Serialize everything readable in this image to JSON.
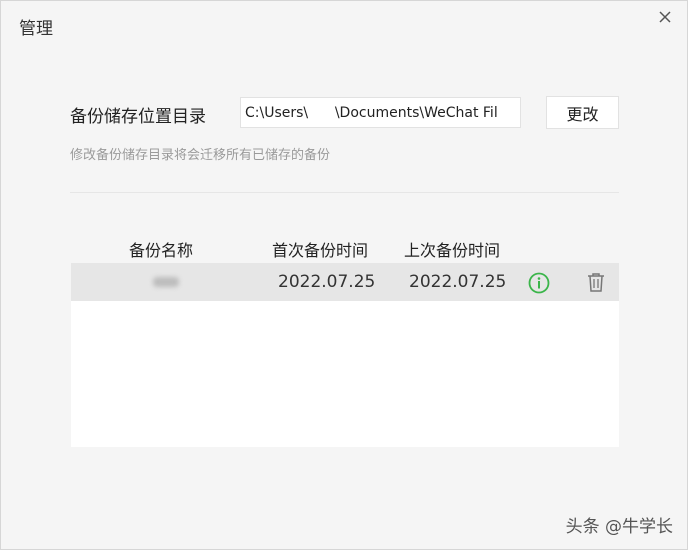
{
  "window": {
    "title": "管理"
  },
  "location": {
    "label": "备份储存位置目录",
    "path_value": "C:\\Users\\      \\Documents\\WeChat Fil",
    "change_button": "更改",
    "hint": "修改备份储存目录将会迁移所有已储存的备份"
  },
  "table": {
    "headers": [
      "备份名称",
      "首次备份时间",
      "上次备份时间"
    ],
    "rows": [
      {
        "name": "",
        "first_time": "2022.07.25",
        "last_time": "2022.07.25"
      }
    ]
  },
  "icons": {
    "close": "close-icon",
    "info": "info-icon",
    "trash": "trash-icon"
  },
  "colors": {
    "info_green": "#3bb54a",
    "row_highlight": "#e6e6e6"
  },
  "watermark": "头条 @牛学长"
}
